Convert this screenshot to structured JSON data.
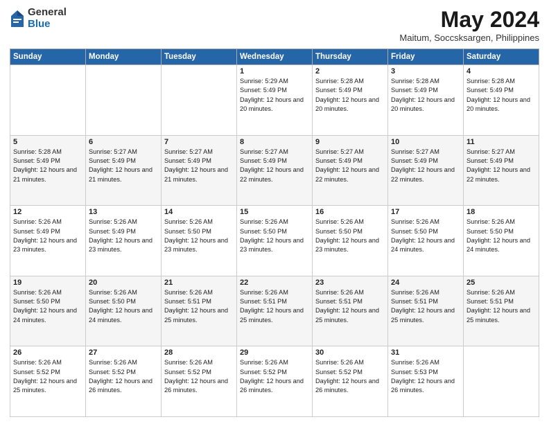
{
  "logo": {
    "general": "General",
    "blue": "Blue"
  },
  "header": {
    "title": "May 2024",
    "subtitle": "Maitum, Soccsksargen, Philippines"
  },
  "weekdays": [
    "Sunday",
    "Monday",
    "Tuesday",
    "Wednesday",
    "Thursday",
    "Friday",
    "Saturday"
  ],
  "weeks": [
    [
      {
        "day": "",
        "info": ""
      },
      {
        "day": "",
        "info": ""
      },
      {
        "day": "",
        "info": ""
      },
      {
        "day": "1",
        "info": "Sunrise: 5:29 AM\nSunset: 5:49 PM\nDaylight: 12 hours\nand 20 minutes."
      },
      {
        "day": "2",
        "info": "Sunrise: 5:28 AM\nSunset: 5:49 PM\nDaylight: 12 hours\nand 20 minutes."
      },
      {
        "day": "3",
        "info": "Sunrise: 5:28 AM\nSunset: 5:49 PM\nDaylight: 12 hours\nand 20 minutes."
      },
      {
        "day": "4",
        "info": "Sunrise: 5:28 AM\nSunset: 5:49 PM\nDaylight: 12 hours\nand 20 minutes."
      }
    ],
    [
      {
        "day": "5",
        "info": "Sunrise: 5:28 AM\nSunset: 5:49 PM\nDaylight: 12 hours\nand 21 minutes."
      },
      {
        "day": "6",
        "info": "Sunrise: 5:27 AM\nSunset: 5:49 PM\nDaylight: 12 hours\nand 21 minutes."
      },
      {
        "day": "7",
        "info": "Sunrise: 5:27 AM\nSunset: 5:49 PM\nDaylight: 12 hours\nand 21 minutes."
      },
      {
        "day": "8",
        "info": "Sunrise: 5:27 AM\nSunset: 5:49 PM\nDaylight: 12 hours\nand 22 minutes."
      },
      {
        "day": "9",
        "info": "Sunrise: 5:27 AM\nSunset: 5:49 PM\nDaylight: 12 hours\nand 22 minutes."
      },
      {
        "day": "10",
        "info": "Sunrise: 5:27 AM\nSunset: 5:49 PM\nDaylight: 12 hours\nand 22 minutes."
      },
      {
        "day": "11",
        "info": "Sunrise: 5:27 AM\nSunset: 5:49 PM\nDaylight: 12 hours\nand 22 minutes."
      }
    ],
    [
      {
        "day": "12",
        "info": "Sunrise: 5:26 AM\nSunset: 5:49 PM\nDaylight: 12 hours\nand 23 minutes."
      },
      {
        "day": "13",
        "info": "Sunrise: 5:26 AM\nSunset: 5:49 PM\nDaylight: 12 hours\nand 23 minutes."
      },
      {
        "day": "14",
        "info": "Sunrise: 5:26 AM\nSunset: 5:50 PM\nDaylight: 12 hours\nand 23 minutes."
      },
      {
        "day": "15",
        "info": "Sunrise: 5:26 AM\nSunset: 5:50 PM\nDaylight: 12 hours\nand 23 minutes."
      },
      {
        "day": "16",
        "info": "Sunrise: 5:26 AM\nSunset: 5:50 PM\nDaylight: 12 hours\nand 23 minutes."
      },
      {
        "day": "17",
        "info": "Sunrise: 5:26 AM\nSunset: 5:50 PM\nDaylight: 12 hours\nand 24 minutes."
      },
      {
        "day": "18",
        "info": "Sunrise: 5:26 AM\nSunset: 5:50 PM\nDaylight: 12 hours\nand 24 minutes."
      }
    ],
    [
      {
        "day": "19",
        "info": "Sunrise: 5:26 AM\nSunset: 5:50 PM\nDaylight: 12 hours\nand 24 minutes."
      },
      {
        "day": "20",
        "info": "Sunrise: 5:26 AM\nSunset: 5:50 PM\nDaylight: 12 hours\nand 24 minutes."
      },
      {
        "day": "21",
        "info": "Sunrise: 5:26 AM\nSunset: 5:51 PM\nDaylight: 12 hours\nand 25 minutes."
      },
      {
        "day": "22",
        "info": "Sunrise: 5:26 AM\nSunset: 5:51 PM\nDaylight: 12 hours\nand 25 minutes."
      },
      {
        "day": "23",
        "info": "Sunrise: 5:26 AM\nSunset: 5:51 PM\nDaylight: 12 hours\nand 25 minutes."
      },
      {
        "day": "24",
        "info": "Sunrise: 5:26 AM\nSunset: 5:51 PM\nDaylight: 12 hours\nand 25 minutes."
      },
      {
        "day": "25",
        "info": "Sunrise: 5:26 AM\nSunset: 5:51 PM\nDaylight: 12 hours\nand 25 minutes."
      }
    ],
    [
      {
        "day": "26",
        "info": "Sunrise: 5:26 AM\nSunset: 5:52 PM\nDaylight: 12 hours\nand 25 minutes."
      },
      {
        "day": "27",
        "info": "Sunrise: 5:26 AM\nSunset: 5:52 PM\nDaylight: 12 hours\nand 26 minutes."
      },
      {
        "day": "28",
        "info": "Sunrise: 5:26 AM\nSunset: 5:52 PM\nDaylight: 12 hours\nand 26 minutes."
      },
      {
        "day": "29",
        "info": "Sunrise: 5:26 AM\nSunset: 5:52 PM\nDaylight: 12 hours\nand 26 minutes."
      },
      {
        "day": "30",
        "info": "Sunrise: 5:26 AM\nSunset: 5:52 PM\nDaylight: 12 hours\nand 26 minutes."
      },
      {
        "day": "31",
        "info": "Sunrise: 5:26 AM\nSunset: 5:53 PM\nDaylight: 12 hours\nand 26 minutes."
      },
      {
        "day": "",
        "info": ""
      }
    ]
  ]
}
